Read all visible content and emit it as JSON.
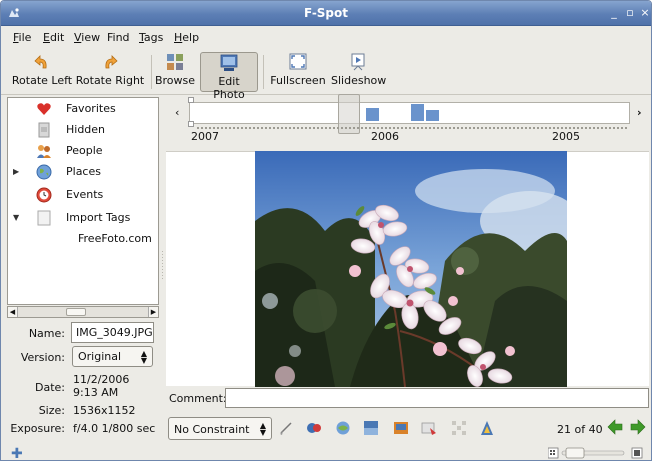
{
  "window": {
    "title": "F-Spot"
  },
  "menubar": {
    "items": [
      {
        "label": "File",
        "mnemonic": "F",
        "rest": "ile"
      },
      {
        "label": "Edit",
        "mnemonic": "E",
        "rest": "dit"
      },
      {
        "label": "View",
        "mnemonic": "V",
        "rest": "iew"
      },
      {
        "label": "Find",
        "mnemonic": "",
        "rest": "Find"
      },
      {
        "label": "Tags",
        "mnemonic": "T",
        "rest": "ags"
      },
      {
        "label": "Help",
        "mnemonic": "H",
        "rest": "elp"
      }
    ]
  },
  "toolbar": {
    "rotate_left": "Rotate Left",
    "rotate_right": "Rotate Right",
    "browse": "Browse",
    "edit_photo": "Edit Photo",
    "fullscreen": "Fullscreen",
    "slideshow": "Slideshow"
  },
  "tags": {
    "items": [
      {
        "label": "Favorites",
        "icon": "heart-icon"
      },
      {
        "label": "Hidden",
        "icon": "hidden-icon"
      },
      {
        "label": "People",
        "icon": "people-icon"
      },
      {
        "label": "Places",
        "icon": "globe-icon"
      },
      {
        "label": "Events",
        "icon": "clock-icon"
      },
      {
        "label": "Import Tags",
        "icon": "import-tags-icon"
      },
      {
        "label": "FreeFoto.com",
        "icon": ""
      }
    ]
  },
  "info": {
    "name_label": "Name:",
    "name_value": "IMG_3049.JPG",
    "version_label": "Version:",
    "version_value": "Original",
    "date_label": "Date:",
    "date_value_line1": "11/2/2006",
    "date_value_line2": "9:13 AM",
    "size_label": "Size:",
    "size_value": "1536x1152",
    "exposure_label": "Exposure:",
    "exposure_value": "f/4.0 1/800 sec"
  },
  "timeline": {
    "years": [
      "2007",
      "2006",
      "2005"
    ]
  },
  "comment": {
    "label": "Comment:",
    "value": ""
  },
  "bottom": {
    "constraint": "No Constraint",
    "counter": "21 of 40"
  },
  "colors": {
    "accent": "#5d7fb5",
    "timeline_bar": "#6a93cc",
    "nav_green": "#3f9a2a"
  }
}
